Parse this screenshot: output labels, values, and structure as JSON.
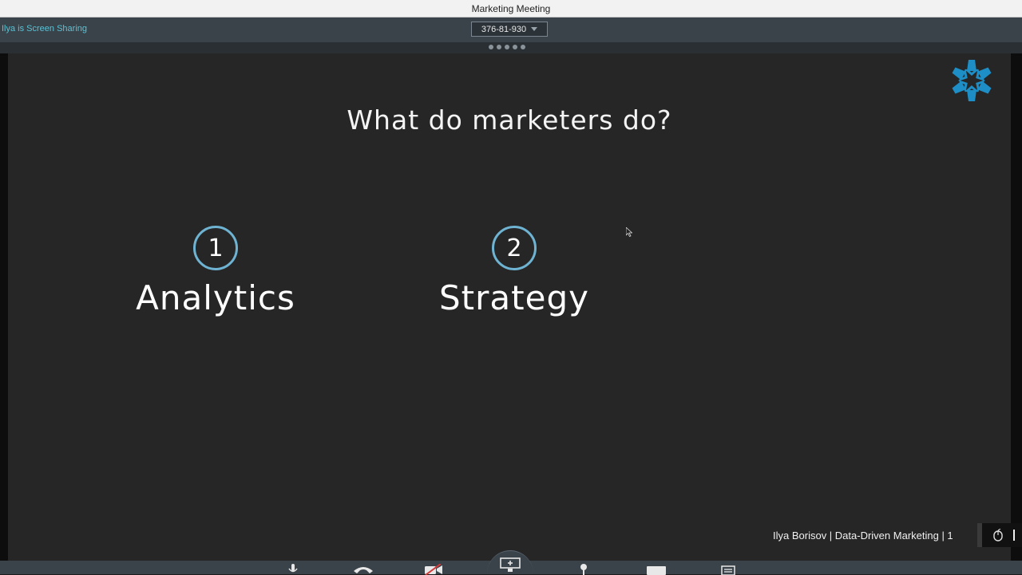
{
  "window": {
    "title": "Marketing Meeting"
  },
  "share_bar": {
    "sharing_status": "Ilya is Screen Sharing",
    "meeting_id": "376-81-930"
  },
  "slide": {
    "title": "What do marketers do?",
    "points": [
      {
        "number": "1",
        "label": "Analytics"
      },
      {
        "number": "2",
        "label": "Strategy"
      }
    ],
    "footer": "Ilya Borisov  |  Data-Driven Marketing  |  1",
    "logo_icon": "asterisk-arrows-logo",
    "accent_color": "#6fb3d3",
    "logo_color": "#1e8fc6"
  },
  "toolbar": {
    "icons": [
      "microphone-icon",
      "phone-icon",
      "video-off-icon",
      "screen-share-icon",
      "pointer-icon",
      "chat-icon",
      "participants-icon"
    ]
  },
  "colors": {
    "share_status_text": "#59c3d6",
    "share_bar_bg": "#3a434a",
    "slide_bg": "#262626"
  }
}
